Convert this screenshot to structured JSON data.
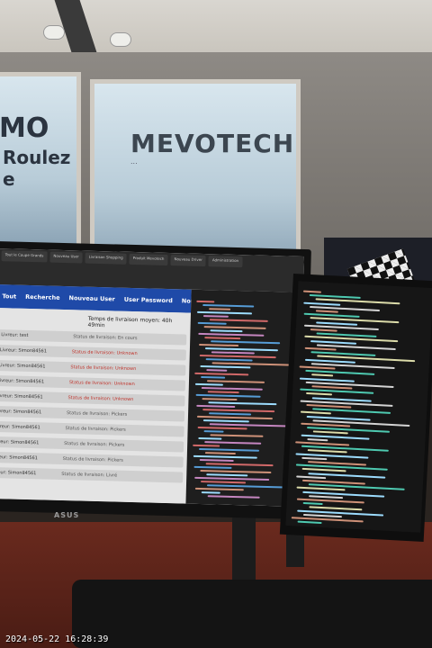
{
  "scene": {
    "window_logo_center": "MEVOTECH",
    "window_logo_left": "MO",
    "window_sub_left": "Roulez e",
    "window_sub_center": "...",
    "timestamp": "2024-05-22 16:28:39",
    "monitor_brand": "ASUS"
  },
  "browser": {
    "tabs": [
      "Tout le Coupe Grands",
      "Nouveau User",
      "Livraison Shopping",
      "Produit Mevotech",
      "Nouveau Driver",
      "Administration"
    ]
  },
  "app": {
    "nav": [
      "Tout",
      "Recherche",
      "Nouveau User",
      "User Password",
      "Nouveau Driver"
    ],
    "header": "Temps de livraison moyen: 40h 49min",
    "rows": [
      {
        "livreur": "Livreur: test",
        "status": "Status de livraison: En cours",
        "tone": "grey"
      },
      {
        "livreur": "Livreur: Simon84561",
        "status": "Status de livraison: Unknown",
        "tone": "red"
      },
      {
        "livreur": "Livreur: Simon84561",
        "status": "Status de livraison: Unknown",
        "tone": "red"
      },
      {
        "livreur": "Livreur: Simon84561",
        "status": "Status de livraison: Unknown",
        "tone": "red"
      },
      {
        "livreur": "Livreur: Simon84561",
        "status": "Status de livraison: Unknown",
        "tone": "red"
      },
      {
        "livreur": "Livreur: Simon84561",
        "status": "Status de livraison: Pickers",
        "tone": "grey"
      },
      {
        "livreur": "Livreur: Simon84561",
        "status": "Status de livraison: Pickers",
        "tone": "grey"
      },
      {
        "livreur": "Livreur: Simon84561",
        "status": "Status de livraison: Pickers",
        "tone": "grey"
      },
      {
        "livreur": "Livreur: Simon84561",
        "status": "Status de livraison: Pickers",
        "tone": "grey"
      },
      {
        "livreur": "Livreur: Simon84561",
        "status": "Status de livraison: Livré",
        "tone": "grey"
      }
    ]
  },
  "colors": {
    "navbar": "#1f4aa8",
    "status_red": "#c0322a",
    "editor_bg": "#1e1e1e"
  }
}
